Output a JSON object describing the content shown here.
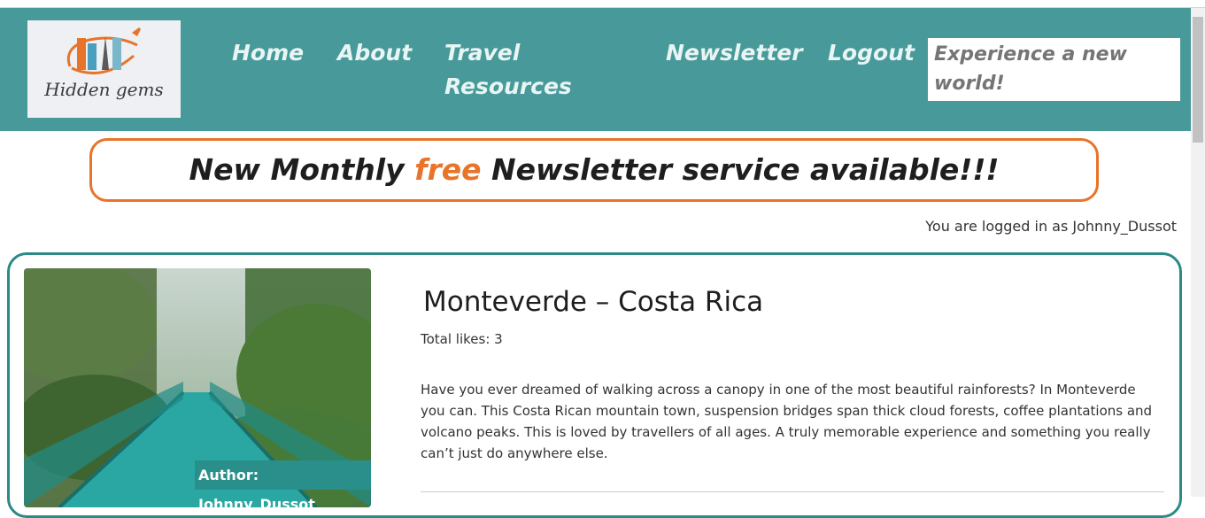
{
  "header": {
    "logo_text": "Hidden gems",
    "nav": {
      "home": "Home",
      "about": "About",
      "travel_resources": "Travel Resources",
      "newsletter": "Newsletter",
      "logout": "Logout"
    },
    "search_placeholder": "Experience a new world!"
  },
  "banner": {
    "before": "New Monthly ",
    "highlight": "free",
    "after": " Newsletter service available!!!"
  },
  "session": {
    "status": "You are logged in as Johnny_Dussot"
  },
  "post": {
    "author": "Author: Johnny_Dussot",
    "title": "Monteverde – Costa Rica",
    "likes": "Total likes: 3",
    "description": "Have you ever dreamed of walking across a canopy in one of the most beautiful rainforests? In Monteverde you can. This Costa Rican mountain town, suspension bridges span thick cloud forests, coffee plantations and volcano peaks. This is loved by travellers of all ages. A truly memorable experience and something you really can’t just do anywhere else."
  },
  "colors": {
    "header_bg": "#479a99",
    "accent_orange": "#e8742a",
    "card_border": "#2a8a86",
    "author_tag_bg": "#2a8f8a"
  }
}
